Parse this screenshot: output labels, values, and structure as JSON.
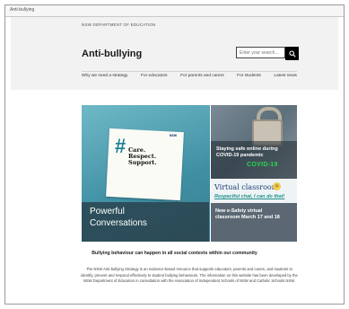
{
  "browser": {
    "title": "Anti-bullying"
  },
  "header": {
    "gov_label": "NSW DEPARTMENT OF EDUCATION",
    "site_title": "Anti-bullying"
  },
  "search": {
    "placeholder": "Enter your search..."
  },
  "nav": {
    "items": [
      "Why we need a strategy",
      "For educators",
      "For parents and carers",
      "For students",
      "Latest news"
    ]
  },
  "hero": {
    "main": {
      "card_hash": "#",
      "card_lines": [
        "Care.",
        "Respect.",
        "Support."
      ],
      "logo_text": "NSW",
      "caption_lines": [
        "Powerful",
        "Conversations"
      ]
    },
    "top_right": {
      "caption_lines": [
        "Staying safe online during",
        "COVID-19 pandemic"
      ],
      "covid_text": "COVID-19"
    },
    "bottom_right": {
      "title": "Virtual classroom",
      "subtitle": "Respectful chat, I can do that!",
      "caption_lines": [
        "New e-Safety virtual",
        "classroom March 17 and 18"
      ]
    }
  },
  "content": {
    "heading": "Bullying behaviour can happen in all social contexts within our community",
    "body": "The NSW Anti-bullying Strategy is an evidence-based resource that supports educators, parents and carers, and students to identify, prevent and respond effectively to student bullying behaviours. The information on this website has been developed by the NSW Department of Education in consultation with the Association of Independent Schools of NSW and Catholic Schools NSW."
  },
  "colors": {
    "header_band": "#f2f2f2",
    "search_button": "#000000",
    "caption_overlay": "#283c46"
  }
}
